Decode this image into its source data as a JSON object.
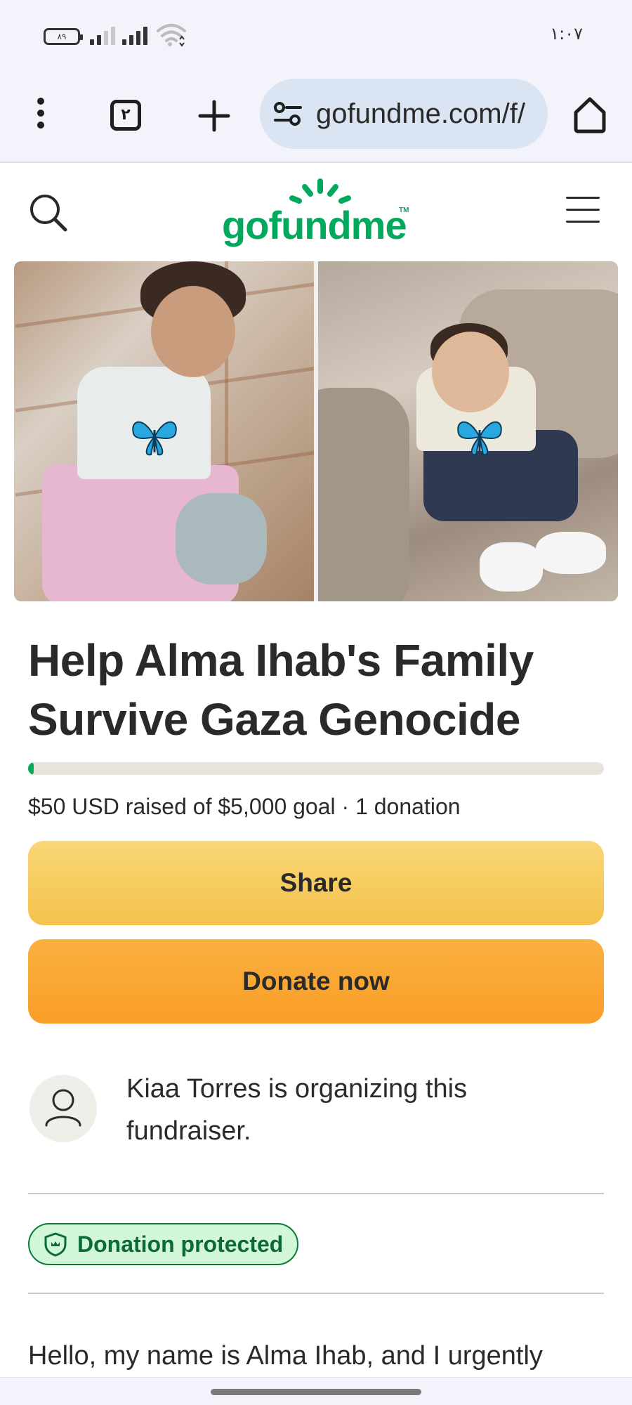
{
  "status_bar": {
    "battery": "٨٩",
    "time": "١:٠٧"
  },
  "browser": {
    "tab_count": "٢",
    "url": "gofundme.com/f/"
  },
  "site": {
    "logo_text": "gofundme",
    "logo_tm": "TM",
    "brand_color": "#02a95c"
  },
  "campaign": {
    "title": "Help Alma Ihab's Family Survive Gaza Genocide",
    "raised_text": "$50 USD raised of $5,000 goal · 1 donation",
    "progress_fraction": 0.01,
    "share_label": "Share",
    "donate_label": "Donate now",
    "organizer_text": "Kiaa Torres is organizing this fundraiser.",
    "protected_label": "Donation protected",
    "story_preview": "Hello, my name is Alma Ihab, and I urgently"
  },
  "icons": {
    "menu": "more-vert-icon",
    "tabs": "tab-switcher-icon",
    "new_tab": "plus-icon",
    "site_info": "tune-icon",
    "home": "home-icon",
    "search": "search-icon",
    "hamburger": "menu-icon",
    "avatar": "person-icon",
    "shield": "shield-icon"
  }
}
